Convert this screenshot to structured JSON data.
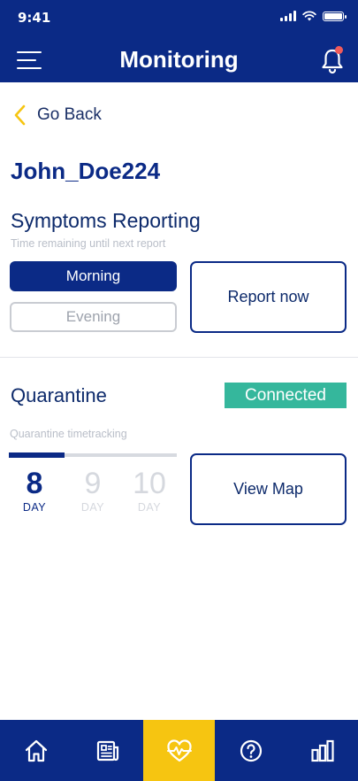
{
  "status_bar": {
    "time": "9:41"
  },
  "header": {
    "title": "Monitoring",
    "has_notification": true
  },
  "nav": {
    "back_label": "Go Back"
  },
  "user": {
    "username": "John_Doe224"
  },
  "symptoms": {
    "title": "Symptoms Reporting",
    "subtitle": "Time remaining until next report",
    "periods": [
      {
        "label": "Morning",
        "selected": true
      },
      {
        "label": "Evening",
        "selected": false
      }
    ],
    "report_button": "Report now"
  },
  "quarantine": {
    "title": "Quarantine",
    "status": "Connected",
    "tracking_label": "Quarantine timetracking",
    "progress_fraction": 0.33,
    "days": [
      {
        "number": "8",
        "label": "DAY",
        "current": true
      },
      {
        "number": "9",
        "label": "DAY",
        "current": false
      },
      {
        "number": "10",
        "label": "DAY",
        "current": false
      }
    ],
    "map_button": "View Map"
  },
  "bottom_nav": {
    "active_index": 2,
    "items": [
      {
        "icon": "home-icon"
      },
      {
        "icon": "news-icon"
      },
      {
        "icon": "heart-pulse-icon"
      },
      {
        "icon": "help-icon"
      },
      {
        "icon": "bar-chart-icon"
      }
    ]
  },
  "colors": {
    "primary": "#0b2a86",
    "accent": "#f6c511",
    "success": "#35b79c",
    "notification": "#f05a5a"
  }
}
